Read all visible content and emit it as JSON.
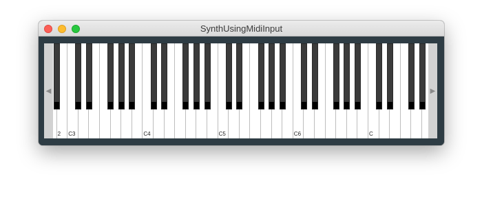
{
  "window": {
    "title": "SynthUsingMidiInput",
    "controls": [
      "close",
      "minimize",
      "zoom"
    ]
  },
  "keyboard": {
    "scroll_left_icon": "left-triangle-icon",
    "scroll_right_icon": "right-triangle-icon",
    "scroll_left_glyph": "◀",
    "scroll_right_glyph": "▶",
    "visible_octave_labels": [
      "2",
      "C3",
      "C4",
      "C5",
      "C6",
      "C"
    ]
  }
}
